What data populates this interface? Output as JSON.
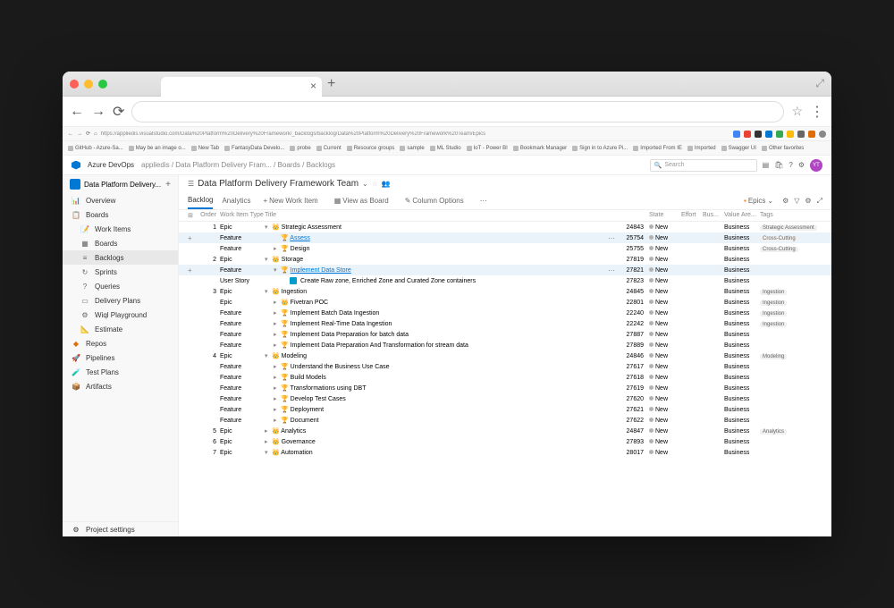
{
  "browser": {
    "mini_url": "https://appliedis.visualstudio.com/Data%20Platform%20Delivery%20Framework/_backlogs/backlog/Data%20Platform%20Delivery%20Framework%20Team/Epics",
    "bookmarks": [
      "GitHub - Azure-Sa...",
      "May be an image o...",
      "New Tab",
      "FantasyData Develo...",
      "probe",
      "Current",
      "Resource groups",
      "sample",
      "ML Studio",
      "IoT - Power BI",
      "Bookmark Manager",
      "Sign in to Azure Pi...",
      "Imported From IE",
      "Imported",
      "Swagger UI",
      "Other favorites"
    ]
  },
  "app": {
    "name": "Azure DevOps",
    "breadcrumb": [
      "appliedis",
      "Data Platform Delivery Fram...",
      "Boards",
      "Backlogs"
    ],
    "search_placeholder": "Search",
    "avatar": "YT"
  },
  "sidebar": {
    "project": "Data Platform Delivery...",
    "items": [
      {
        "label": "Overview",
        "icon": "📊",
        "color": "#0078d4"
      },
      {
        "label": "Boards",
        "icon": "📋",
        "color": "#009688",
        "section": true
      },
      {
        "label": "Work Items",
        "icon": "📝",
        "l2": true
      },
      {
        "label": "Boards",
        "icon": "▦",
        "l2": true
      },
      {
        "label": "Backlogs",
        "icon": "≡",
        "l2": true,
        "active": true
      },
      {
        "label": "Sprints",
        "icon": "↻",
        "l2": true
      },
      {
        "label": "Queries",
        "icon": "?",
        "l2": true
      },
      {
        "label": "Delivery Plans",
        "icon": "▭",
        "l2": true
      },
      {
        "label": "Wiql Playground",
        "icon": "⚙",
        "l2": true
      },
      {
        "label": "Estimate",
        "icon": "📐",
        "l2": true
      },
      {
        "label": "Repos",
        "icon": "◆",
        "color": "#e06c00"
      },
      {
        "label": "Pipelines",
        "icon": "🚀",
        "color": "#0078d4"
      },
      {
        "label": "Test Plans",
        "icon": "🧪",
        "color": "#009688"
      },
      {
        "label": "Artifacts",
        "icon": "📦",
        "color": "#e06c00"
      }
    ],
    "bottom": "Project settings"
  },
  "page": {
    "title": "Data Platform Delivery Framework Team",
    "tabs": [
      "Backlog",
      "Analytics"
    ],
    "active_tab": 0,
    "toolbar": {
      "new": "New Work Item",
      "view_board": "View as Board",
      "col_opts": "Column Options"
    },
    "level": "Epics"
  },
  "columns": [
    "",
    "Order",
    "Work Item Type",
    "Title",
    "",
    "",
    "State",
    "Effort",
    "Bus...",
    "Value Are...",
    "Tags"
  ],
  "rows": [
    {
      "order": "1",
      "type": "Epic",
      "title": "Strategic Assessment",
      "id": "24843",
      "state": "New",
      "value": "Business",
      "tag": "Strategic Assessment",
      "icon": "crown",
      "indent": 0,
      "exp": "▾"
    },
    {
      "type": "Feature",
      "title": "Assess",
      "id": "25754",
      "state": "New",
      "value": "Business",
      "tag": "Cross-Cutting",
      "icon": "trophy",
      "indent": 1,
      "hl": true,
      "add": true,
      "more": true,
      "link": true
    },
    {
      "type": "Feature",
      "title": "Design",
      "id": "25755",
      "state": "New",
      "value": "Business",
      "tag": "Cross-Cutting",
      "icon": "trophy",
      "indent": 1,
      "exp": "▸"
    },
    {
      "order": "2",
      "type": "Epic",
      "title": "Storage",
      "id": "27819",
      "state": "New",
      "value": "Business",
      "icon": "crown",
      "indent": 0,
      "exp": "▾"
    },
    {
      "type": "Feature",
      "title": "Implement Data Store",
      "id": "27821",
      "state": "New",
      "value": "Business",
      "icon": "trophy",
      "indent": 1,
      "hl": true,
      "add": true,
      "more": true,
      "link": true,
      "exp": "▾"
    },
    {
      "type": "User Story",
      "title": "Create Raw zone, Enriched Zone and Curated Zone containers",
      "id": "27823",
      "state": "New",
      "value": "Business",
      "icon": "story",
      "indent": 2
    },
    {
      "order": "3",
      "type": "Epic",
      "title": "Ingestion",
      "id": "24845",
      "state": "New",
      "value": "Business",
      "tag": "Ingestion",
      "icon": "crown",
      "indent": 0,
      "exp": "▾"
    },
    {
      "type": "Epic",
      "title": "Fivetran POC",
      "id": "22801",
      "state": "New",
      "value": "Business",
      "tag": "Ingestion",
      "icon": "crown",
      "indent": 1,
      "exp": "▸"
    },
    {
      "type": "Feature",
      "title": "Implement Batch Data Ingestion",
      "id": "22240",
      "state": "New",
      "value": "Business",
      "tag": "Ingestion",
      "icon": "trophy",
      "indent": 1,
      "exp": "▸"
    },
    {
      "type": "Feature",
      "title": "Implement Real-Time Data Ingestion",
      "id": "22242",
      "state": "New",
      "value": "Business",
      "tag": "Ingestion",
      "icon": "trophy",
      "indent": 1,
      "exp": "▸"
    },
    {
      "type": "Feature",
      "title": "Implement Data Preparation for batch data",
      "id": "27887",
      "state": "New",
      "value": "Business",
      "icon": "trophy",
      "indent": 1,
      "exp": "▸"
    },
    {
      "type": "Feature",
      "title": "Implement Data Preparation And Transformation for stream data",
      "id": "27889",
      "state": "New",
      "value": "Business",
      "icon": "trophy",
      "indent": 1,
      "exp": "▸"
    },
    {
      "order": "4",
      "type": "Epic",
      "title": "Modeling",
      "id": "24846",
      "state": "New",
      "value": "Business",
      "tag": "Modeling",
      "icon": "crown",
      "indent": 0,
      "exp": "▾"
    },
    {
      "type": "Feature",
      "title": "Understand the Business Use Case",
      "id": "27617",
      "state": "New",
      "value": "Business",
      "icon": "trophy",
      "indent": 1,
      "exp": "▸"
    },
    {
      "type": "Feature",
      "title": "Build Models",
      "id": "27618",
      "state": "New",
      "value": "Business",
      "icon": "trophy",
      "indent": 1,
      "exp": "▸"
    },
    {
      "type": "Feature",
      "title": "Transformations using DBT",
      "id": "27619",
      "state": "New",
      "value": "Business",
      "icon": "trophy",
      "indent": 1,
      "exp": "▸"
    },
    {
      "type": "Feature",
      "title": "Develop Test Cases",
      "id": "27620",
      "state": "New",
      "value": "Business",
      "icon": "trophy",
      "indent": 1,
      "exp": "▸"
    },
    {
      "type": "Feature",
      "title": "Deployment",
      "id": "27621",
      "state": "New",
      "value": "Business",
      "icon": "trophy",
      "indent": 1,
      "exp": "▸"
    },
    {
      "type": "Feature",
      "title": "Document",
      "id": "27622",
      "state": "New",
      "value": "Business",
      "icon": "trophy",
      "indent": 1,
      "exp": "▸"
    },
    {
      "order": "5",
      "type": "Epic",
      "title": "Analytics",
      "id": "24847",
      "state": "New",
      "value": "Business",
      "tag": "Analytics",
      "icon": "crown",
      "indent": 0,
      "exp": "▸"
    },
    {
      "order": "6",
      "type": "Epic",
      "title": "Governance",
      "id": "27893",
      "state": "New",
      "value": "Business",
      "icon": "crown",
      "indent": 0,
      "exp": "▸"
    },
    {
      "order": "7",
      "type": "Epic",
      "title": "Automation",
      "id": "28017",
      "state": "New",
      "value": "Business",
      "icon": "crown",
      "indent": 0,
      "exp": "▾"
    }
  ]
}
